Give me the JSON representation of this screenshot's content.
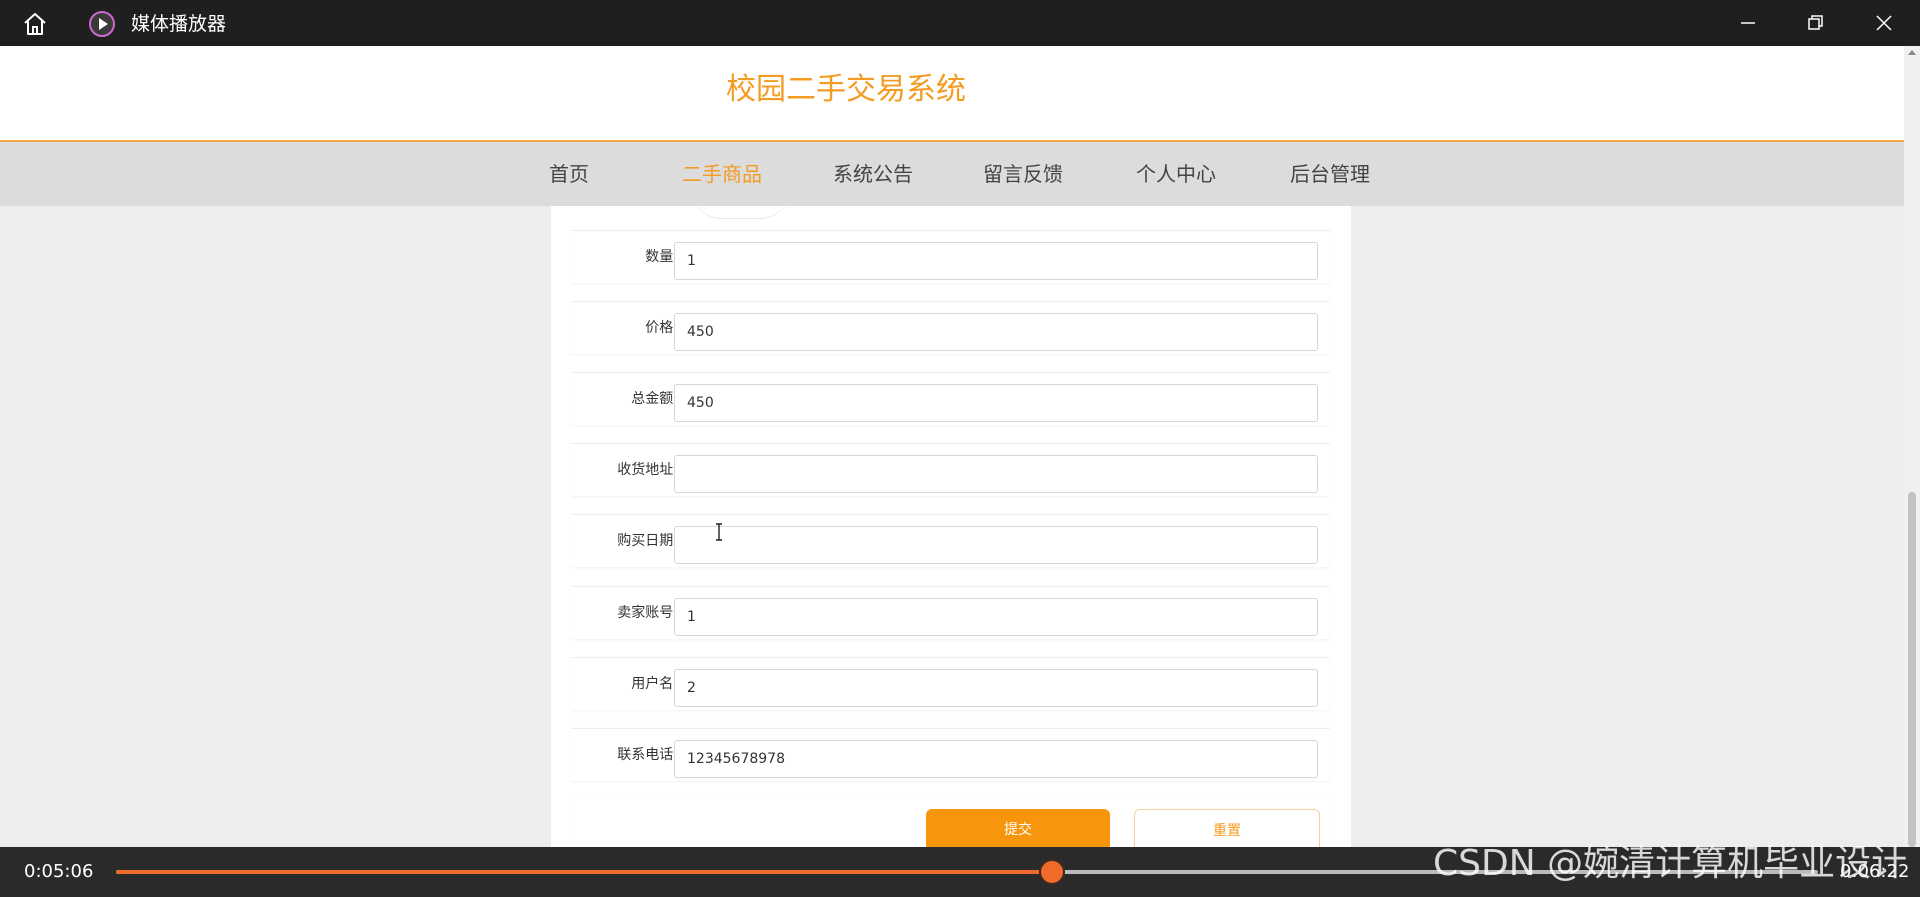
{
  "window": {
    "app_title": "媒体播放器",
    "icons": {
      "home": "home-icon",
      "app": "media-player-icon",
      "minimize": "minimize-icon",
      "maximize": "restore-icon",
      "close": "close-icon"
    }
  },
  "site": {
    "title": "校园二手交易系统",
    "accent_color": "#f39b22"
  },
  "nav": {
    "items": [
      {
        "label": "首页"
      },
      {
        "label": "二手商品"
      },
      {
        "label": "系统公告"
      },
      {
        "label": "留言反馈"
      },
      {
        "label": "个人中心"
      },
      {
        "label": "后台管理"
      }
    ],
    "active": "二手商品"
  },
  "form": {
    "rows": [
      {
        "label": "数量:",
        "value": "1"
      },
      {
        "label": "价格:",
        "value": "450"
      },
      {
        "label": "总金额:",
        "value": "450"
      },
      {
        "label": "收货地址:",
        "value": ""
      },
      {
        "label": "购买日期:",
        "value": ""
      },
      {
        "label": "卖家账号:",
        "value": "1"
      },
      {
        "label": "用户名:",
        "value": "2"
      },
      {
        "label": "联系电话:",
        "value": "12345678978"
      }
    ],
    "submit_label": "提交",
    "reset_label": "重置"
  },
  "player": {
    "current_time": "0:05:06",
    "total_time": "0:06:22",
    "progress": 0.55
  },
  "watermark": "CSDN @婉清计算机毕业设计"
}
